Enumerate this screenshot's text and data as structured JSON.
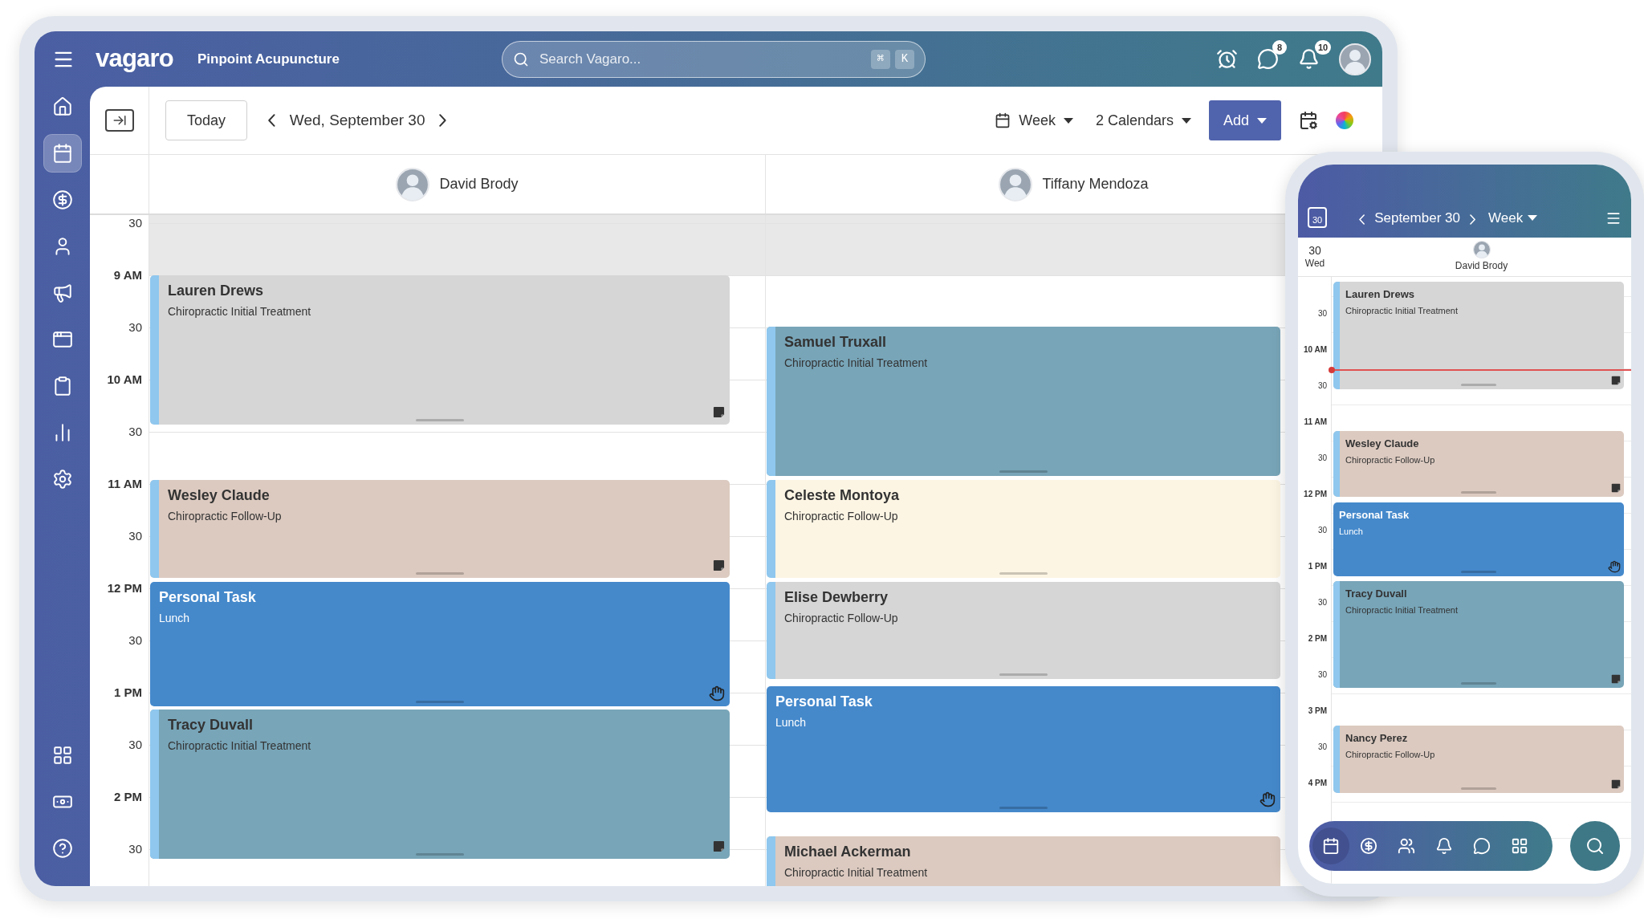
{
  "top_bar": {
    "logo": "vagaro",
    "business": "Pinpoint Acupuncture",
    "search": {
      "placeholder": "Search Vagaro...",
      "keys": [
        "⌘",
        "K"
      ]
    },
    "chat_badge": "8",
    "notification_badge": "10"
  },
  "sidebar": {
    "items": [
      {
        "kind": "home",
        "selected": false
      },
      {
        "kind": "calendar",
        "selected": true
      },
      {
        "kind": "money",
        "selected": false
      },
      {
        "kind": "client",
        "selected": false
      },
      {
        "kind": "marketing",
        "selected": false
      },
      {
        "kind": "website",
        "selected": false
      },
      {
        "kind": "forms",
        "selected": false
      },
      {
        "kind": "reports",
        "selected": false
      },
      {
        "kind": "settings",
        "selected": false
      }
    ],
    "bottom_items": [
      {
        "kind": "apps",
        "selected": false
      },
      {
        "kind": "cash",
        "selected": false
      },
      {
        "kind": "help",
        "selected": false
      }
    ]
  },
  "toolbar": {
    "today": "Today",
    "date": "Wed, September 30",
    "view": "Week",
    "calendars": "2 Calendars",
    "add": "Add"
  },
  "calendar": {
    "time_labels": [
      "30",
      "9 AM",
      "30",
      "10 AM",
      "30",
      "11 AM",
      "30",
      "12 PM",
      "30",
      "1 PM",
      "30",
      "2 PM",
      "30"
    ],
    "columns": [
      {
        "name": "David Brody",
        "events": [
          {
            "title": "Lauren Drews",
            "subtitle": "Chiropractic Initial Treatment",
            "kind": "appointment",
            "color": "#d6d6d6",
            "note": true
          },
          {
            "title": "Wesley Claude",
            "subtitle": "Chiropractic Follow-Up",
            "kind": "appointment",
            "color": "#dccac0",
            "note": true
          },
          {
            "title": "Personal Task",
            "subtitle": "Lunch",
            "kind": "task",
            "color": "#4589cb"
          },
          {
            "title": "Tracy Duvall",
            "subtitle": "Chiropractic Initial Treatment",
            "kind": "appointment",
            "color": "#78a5b8",
            "note": true
          }
        ]
      },
      {
        "name": "Tiffany Mendoza",
        "events": [
          {
            "title": "Samuel Truxall",
            "subtitle": "Chiropractic Initial Treatment",
            "kind": "appointment",
            "color": "#78a5b8"
          },
          {
            "title": "Celeste Montoya",
            "subtitle": "Chiropractic Follow-Up",
            "kind": "appointment",
            "color": "#fdf5e4"
          },
          {
            "title": "Elise Dewberry",
            "subtitle": "Chiropractic Follow-Up",
            "kind": "appointment",
            "color": "#d6d6d6"
          },
          {
            "title": "Personal Task",
            "subtitle": "Lunch",
            "kind": "task",
            "color": "#4589cb"
          },
          {
            "title": "Michael Ackerman",
            "subtitle": "Chiropractic Initial Treatment",
            "kind": "appointment",
            "color": "#dccac0"
          }
        ]
      }
    ]
  },
  "phone": {
    "calendar_icon_day": "30",
    "date": "September 30",
    "view": "Week",
    "day_number": "30",
    "weekday": "Wed",
    "staff": "David Brody",
    "time_labels": [
      "30",
      "10 AM",
      "30",
      "11 AM",
      "30",
      "12 PM",
      "30",
      "1 PM",
      "30",
      "2 PM",
      "30",
      "3 PM",
      "30",
      "4 PM"
    ],
    "events": [
      {
        "title": "Lauren Drews",
        "subtitle": "Chiropractic Initial Treatment",
        "kind": "appointment",
        "color": "#d6d6d6",
        "note": true
      },
      {
        "title": "Wesley Claude",
        "subtitle": "Chiropractic Follow-Up",
        "kind": "appointment",
        "color": "#dccac0",
        "note": true
      },
      {
        "title": "Personal Task",
        "subtitle": "Lunch",
        "kind": "task",
        "color": "#4589cb"
      },
      {
        "title": "Tracy Duvall",
        "subtitle": "Chiropractic Initial Treatment",
        "kind": "appointment",
        "color": "#78a5b8",
        "note": true
      },
      {
        "title": "Nancy Perez",
        "subtitle": "Chiropractic Follow-Up",
        "kind": "appointment",
        "color": "#dccac0",
        "note": true
      }
    ],
    "nav": [
      {
        "kind": "calendar",
        "selected": true
      },
      {
        "kind": "money",
        "selected": false
      },
      {
        "kind": "clients",
        "selected": false
      },
      {
        "kind": "alerts",
        "selected": false
      },
      {
        "kind": "messages",
        "selected": false
      },
      {
        "kind": "apps",
        "selected": false
      }
    ]
  }
}
